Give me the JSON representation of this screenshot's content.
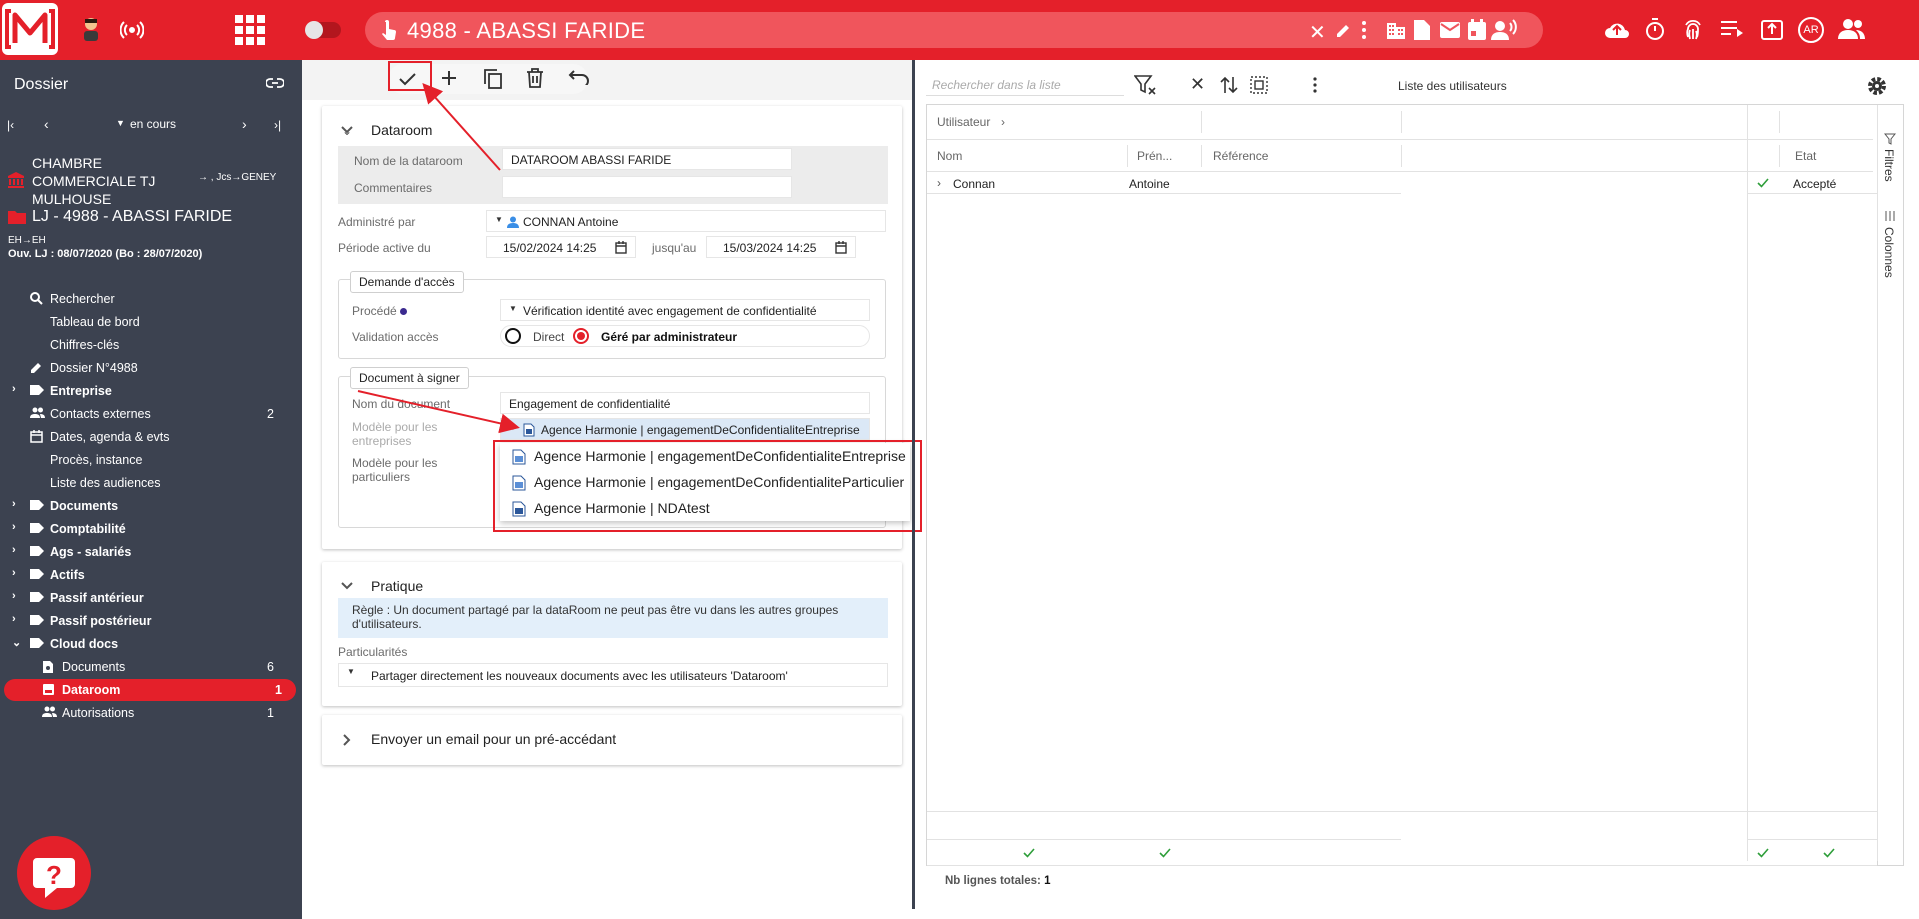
{
  "topbar": {
    "title": "4988 - ABASSI FARIDE",
    "avatar_initials": "AR"
  },
  "sidebar": {
    "header": "Dossier",
    "nav_status": "en cours",
    "court": "CHAMBRE COMMERCIALE TJ MULHOUSE",
    "court_line1": "CHAMBRE",
    "court_line2": "COMMERCIALE TJ",
    "court_line3": "MULHOUSE",
    "court_assign": "→ , Jcs→GENEY",
    "case_title": "LJ - 4988 - ABASSI FARIDE",
    "case_eh": "EH→EH",
    "case_dates": "Ouv. LJ : 08/07/2020 (Bo : 28/07/2020)",
    "items": [
      {
        "label": "Rechercher",
        "icon": "search-icon",
        "bold": false,
        "count": ""
      },
      {
        "label": "Tableau de bord",
        "icon": "",
        "bold": false,
        "count": ""
      },
      {
        "label": "Chiffres-clés",
        "icon": "",
        "bold": false,
        "count": ""
      },
      {
        "label": "Dossier N°4988",
        "icon": "pencil-icon",
        "bold": false,
        "count": ""
      },
      {
        "label": "Entreprise",
        "icon": "tag-icon",
        "bold": true,
        "count": ""
      },
      {
        "label": "Contacts externes",
        "icon": "people-icon",
        "bold": false,
        "count": "2"
      },
      {
        "label": "Dates, agenda & evts",
        "icon": "calendar-icon",
        "bold": false,
        "count": ""
      },
      {
        "label": "Procès, instance",
        "icon": "",
        "bold": false,
        "count": ""
      },
      {
        "label": "Liste des audiences",
        "icon": "",
        "bold": false,
        "count": ""
      },
      {
        "label": "Documents",
        "icon": "tag-icon",
        "bold": true,
        "count": ""
      },
      {
        "label": "Comptabilité",
        "icon": "tag-icon",
        "bold": true,
        "count": ""
      },
      {
        "label": "Ags - salariés",
        "icon": "tag-icon",
        "bold": true,
        "count": ""
      },
      {
        "label": "Actifs",
        "icon": "tag-icon",
        "bold": true,
        "count": ""
      },
      {
        "label": "Passif antérieur",
        "icon": "tag-icon",
        "bold": true,
        "count": ""
      },
      {
        "label": "Passif postérieur",
        "icon": "tag-icon",
        "bold": true,
        "count": ""
      },
      {
        "label": "Cloud docs",
        "icon": "tag-icon",
        "bold": true,
        "count": ""
      },
      {
        "label": "Documents",
        "icon": "doc-search-icon",
        "bold": false,
        "count": "6"
      },
      {
        "label": "Dataroom",
        "icon": "dataroom-icon",
        "bold": true,
        "count": "1"
      },
      {
        "label": "Autorisations",
        "icon": "people-icon",
        "bold": false,
        "count": "1"
      }
    ]
  },
  "dataroom": {
    "section_title": "Dataroom",
    "name_label": "Nom de la dataroom",
    "name_value": "DATAROOM ABASSI FARIDE",
    "comments_label": "Commentaires",
    "comments_value": "",
    "admin_label": "Administré par",
    "admin_value": "CONNAN Antoine",
    "period_label": "Période active du",
    "period_from": "15/02/2024 14:25",
    "period_until_label": "jusqu'au",
    "period_to": "15/03/2024 14:25",
    "access_title": "Demande d'accès",
    "procede_label": "Procédé",
    "procede_value": "Vérification identité avec engagement de confidentialité",
    "validation_label": "Validation accès",
    "validation_direct": "Direct",
    "validation_admin": "Géré par administrateur",
    "doc_title": "Document à signer",
    "docname_label": "Nom du document",
    "docname_value": "Engagement de confidentialité",
    "model_ent_label_1": "Modèle pour les",
    "model_ent_label_2": "entreprises",
    "model_ent_value": "Agence Harmonie | engagementDeConfidentialiteEntreprise",
    "model_part_label_1": "Modèle pour les",
    "model_part_label_2": "particuliers",
    "dropdown_options": [
      "Agence Harmonie | engagementDeConfidentialiteEntreprise",
      "Agence Harmonie | engagementDeConfidentialiteParticulier",
      "Agence Harmonie | NDAtest"
    ]
  },
  "pratique": {
    "title": "Pratique",
    "rule_line1": "Règle : Un document partagé par la dataRoom ne peut pas être vu dans les autres groupes",
    "rule_line2": "d'utilisateurs.",
    "particularites_label": "Particularités",
    "particularites_value": "Partager directement les nouveaux documents avec les utilisateurs 'Dataroom'"
  },
  "email_section": {
    "title": "Envoyer un email pour un pré-accédant"
  },
  "users_panel": {
    "search_placeholder": "Rechercher dans la liste",
    "title": "Liste des utilisateurs",
    "group_header": "Utilisateur",
    "columns": [
      "Nom",
      "Prén...",
      "Référence",
      "Etat"
    ],
    "rows": [
      {
        "nom": "Connan",
        "prenom": "Antoine",
        "reference": "",
        "etat": "Accepté"
      }
    ],
    "filters_label": "Filtres",
    "columns_label": "Colonnes",
    "total_label": "Nb lignes totales:",
    "total_value": "1"
  },
  "colors": {
    "brand_red": "#e4202a",
    "sidebar_bg": "#3c4250",
    "accept_green": "#2e9e3a",
    "info_bg": "#e3effa"
  }
}
